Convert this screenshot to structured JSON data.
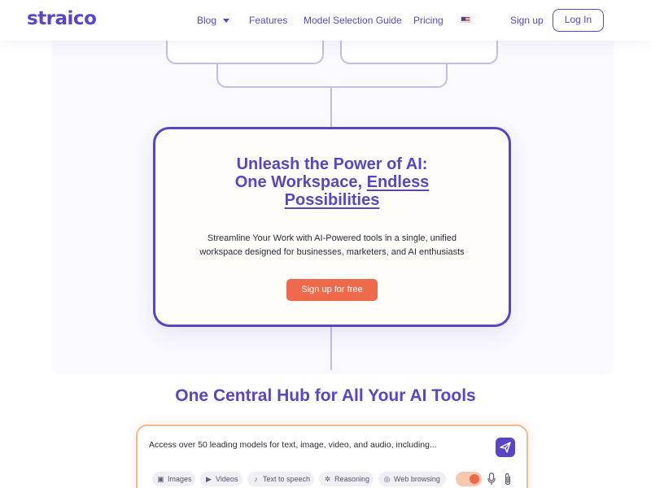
{
  "header": {
    "logo": "straico",
    "nav": [
      "Blog",
      "Features",
      "Model Selection Guide",
      "Pricing"
    ],
    "signup": "Sign up",
    "login": "Log In"
  },
  "hero": {
    "title_line1": "Unleash the Power of AI:",
    "title_line2_prefix": "One Workspace, ",
    "title_line2_link": "Endless",
    "title_line3": "Possibilities",
    "subtitle_line1": "Streamline Your Work with AI-Powered tools in a single, unified",
    "subtitle_line2": "workspace designed for businesses, marketers, and AI enthusiasts",
    "cta": "Sign up for free"
  },
  "hub": {
    "title": "One Central Hub for All Your AI Tools",
    "prompt_text": "Access over 50 leading models for text, image, video, and audio, including...",
    "chips": [
      {
        "label": "Images",
        "icon": "image-icon"
      },
      {
        "label": "Videos",
        "icon": "video-icon"
      },
      {
        "label": "Text to speech",
        "icon": "speaker-icon"
      },
      {
        "label": "Reasoning",
        "icon": "reasoning-icon"
      },
      {
        "label": "Web browsing",
        "icon": "globe-icon"
      }
    ]
  },
  "colors": {
    "brand": "#5b44c6",
    "accent": "#ee6a4b",
    "connector": "#c3bdea"
  }
}
